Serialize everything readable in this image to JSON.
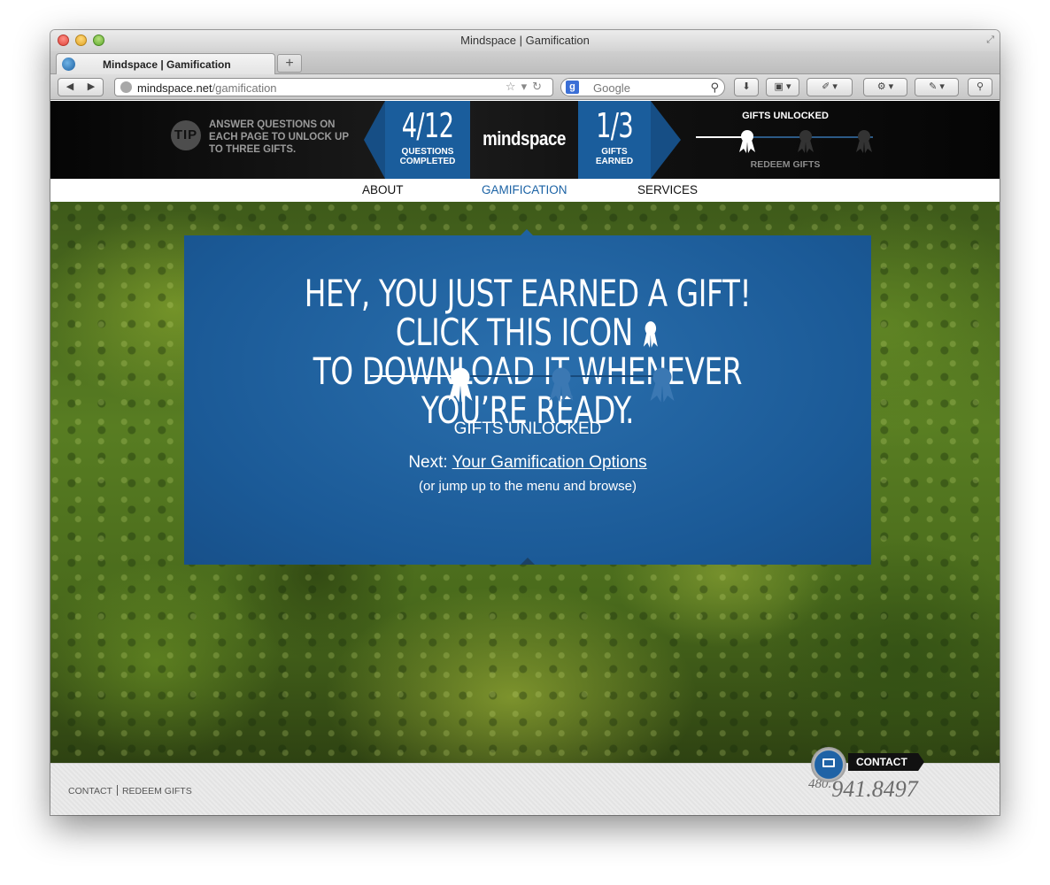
{
  "window": {
    "title": "Mindspace | Gamification",
    "tab_label": "Mindspace | Gamification",
    "new_tab_symbol": "+",
    "url_domain": "mindspace.net",
    "url_path": "/gamification",
    "search_engine_letter": "g",
    "search_placeholder": "Google"
  },
  "hud": {
    "tip_badge": "TIP",
    "tip_text": "ANSWER QUESTIONS ON EACH PAGE TO UNLOCK UP TO THREE GIFTS.",
    "questions_value": "4/12",
    "questions_label_1": "QUESTIONS",
    "questions_label_2": "COMPLETED",
    "logo": "mindspace",
    "gifts_value": "1/3",
    "gifts_label_1": "GIFTS",
    "gifts_label_2": "EARNED",
    "gifts_unlocked_title": "GIFTS UNLOCKED",
    "redeem_label": "REDEEM GIFTS",
    "gifts_unlocked_count": 1,
    "gifts_total": 3
  },
  "nav": {
    "items": [
      {
        "label": "ABOUT"
      },
      {
        "label": "GAMIFICATION",
        "active": true
      },
      {
        "label": "SERVICES"
      }
    ]
  },
  "modal": {
    "headline_part1": "HEY, YOU JUST EARNED A GIFT! CLICK THIS ICON",
    "headline_part2": "TO DOWNLOAD IT WHENEVER YOU’RE READY.",
    "gifts_unlocked": "GIFTS UNLOCKED",
    "next_prefix": "Next:",
    "next_link": "Your Gamification Options",
    "jump_text": "(or jump up to the menu and browse)"
  },
  "footer": {
    "contact_link": "CONTACT",
    "redeem_link": "REDEEM GIFTS",
    "contact_tag": "CONTACT",
    "phone_area": "480.",
    "phone_number": "941.8497"
  },
  "colors": {
    "brand_blue": "#1a5d9c",
    "active_nav": "#1c63a5",
    "hud_bg": "#111111"
  },
  "icons": {
    "gift": "ribbon-award-icon",
    "contact": "envelope-icon",
    "search": "magnifier-icon"
  }
}
